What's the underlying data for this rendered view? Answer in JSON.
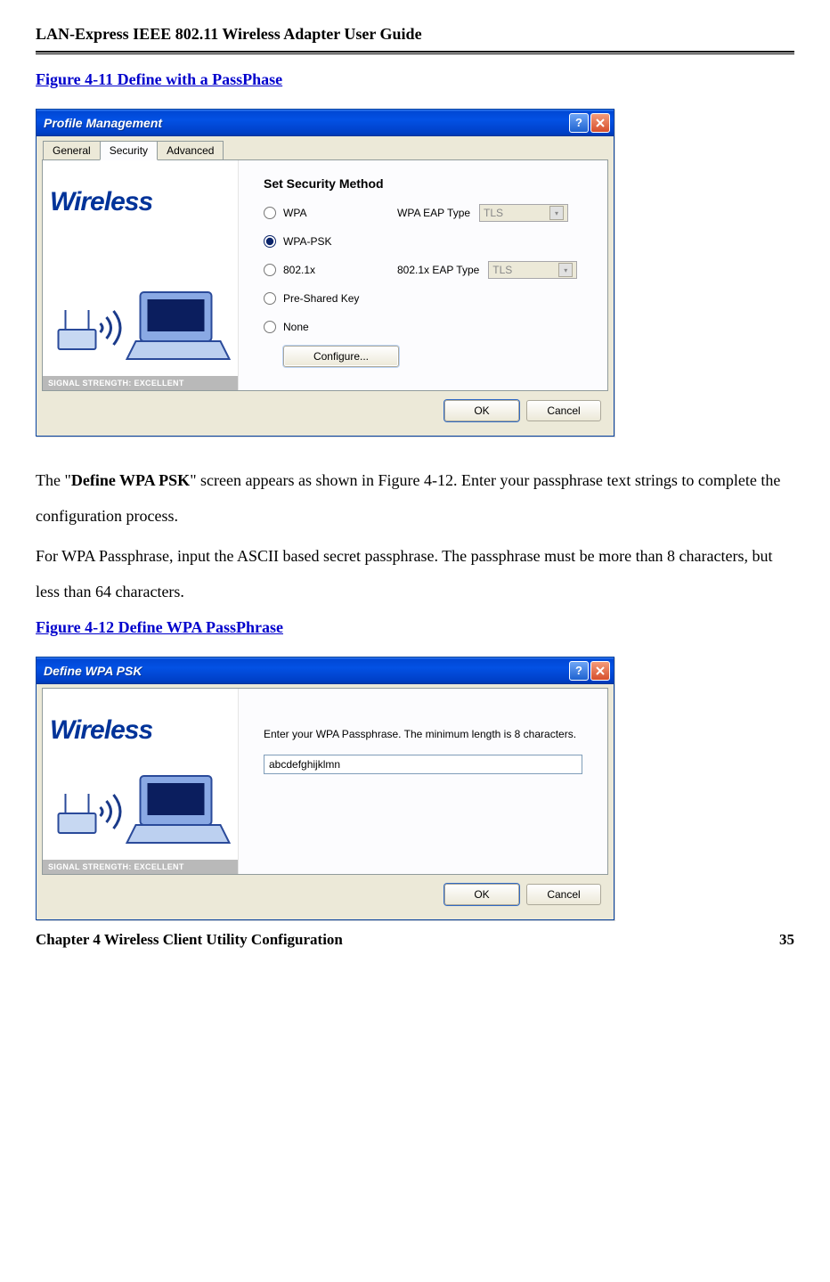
{
  "header": {
    "title": "LAN-Express IEEE 802.11 Wireless Adapter User Guide"
  },
  "fig1": {
    "caption": "Figure 4-11 Define with a PassPhase"
  },
  "dialog1": {
    "title": "Profile Management",
    "tabs": {
      "general": "General",
      "security": "Security",
      "advanced": "Advanced"
    },
    "brand": "Wireless",
    "signal_label": "SIGNAL STRENGTH:",
    "signal_value": "EXCELLENT",
    "section_title": "Set Security Method",
    "options": {
      "wpa": "WPA",
      "wpa_psk": "WPA-PSK",
      "dot1x": "802.1x",
      "psk": "Pre-Shared Key",
      "none": "None"
    },
    "eap": {
      "wpa_label": "WPA EAP Type",
      "dot1x_label": "802.1x EAP Type",
      "value": "TLS"
    },
    "configure": "Configure...",
    "ok": "OK",
    "cancel": "Cancel"
  },
  "para": {
    "p1a": "The \"",
    "p1b": "Define WPA PSK",
    "p1c": "\" screen appears as shown in Figure 4-12. Enter your passphrase text strings to complete the configuration process.",
    "p2": "For WPA Passphrase, input the ASCII based secret passphrase.  The passphrase must be more than 8 characters, but less than 64 characters."
  },
  "fig2": {
    "caption": "Figure 4-12 Define WPA PassPhrase"
  },
  "dialog2": {
    "title": "Define WPA PSK",
    "brand": "Wireless",
    "signal_label": "SIGNAL STRENGTH:",
    "signal_value": "EXCELLENT",
    "label": "Enter your WPA Passphrase.  The minimum length is 8 characters.",
    "value": "abcdefghijklmn",
    "ok": "OK",
    "cancel": "Cancel"
  },
  "footer": {
    "chapter": "Chapter 4 Wireless Client Utility Configuration",
    "page": "35"
  }
}
